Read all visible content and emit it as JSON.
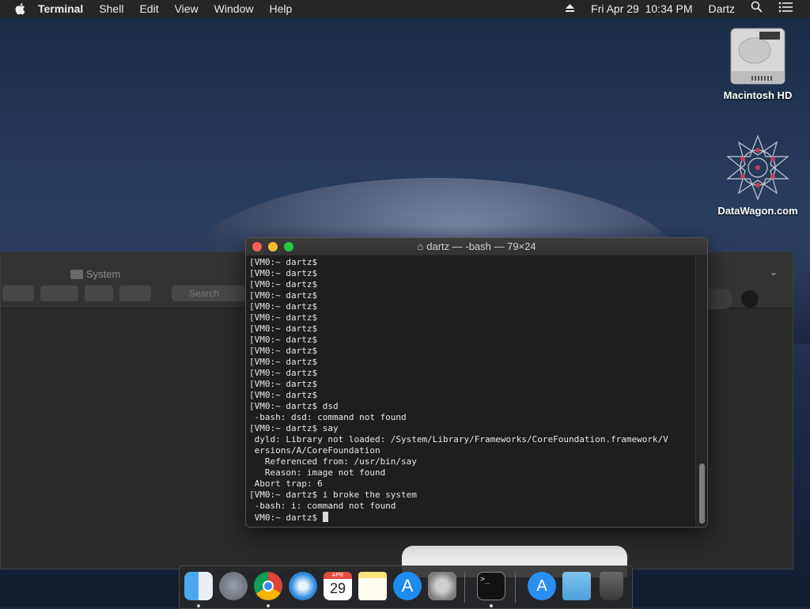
{
  "menubar": {
    "app_name": "Terminal",
    "menus": [
      "Shell",
      "Edit",
      "View",
      "Window",
      "Help"
    ],
    "date_time": "Fri Apr 29  10:34 PM",
    "user": "Dartz"
  },
  "desktop": {
    "icons": [
      {
        "label": "Macintosh HD",
        "icon": "hard-drive-icon"
      },
      {
        "label": "DataWagon.com",
        "icon": "geometric-star-icon"
      }
    ]
  },
  "finder": {
    "title": "System",
    "search_placeholder": "Search"
  },
  "terminal": {
    "title": "dartz — -bash — 79×24",
    "lines": [
      "[VM0:~ dartz$",
      "[VM0:~ dartz$",
      "[VM0:~ dartz$",
      "[VM0:~ dartz$",
      "[VM0:~ dartz$",
      "[VM0:~ dartz$",
      "[VM0:~ dartz$",
      "[VM0:~ dartz$",
      "[VM0:~ dartz$",
      "[VM0:~ dartz$",
      "[VM0:~ dartz$",
      "[VM0:~ dartz$",
      "[VM0:~ dartz$",
      "[VM0:~ dartz$ dsd",
      " -bash: dsd: command not found",
      "[VM0:~ dartz$ say",
      " dyld: Library not loaded: /System/Library/Frameworks/CoreFoundation.framework/V",
      " ersions/A/CoreFoundation",
      "   Referenced from: /usr/bin/say",
      "   Reason: image not found",
      " Abort trap: 6",
      "[VM0:~ dartz$ i broke the system",
      " -bash: i: command not found",
      " VM0:~ dartz$ "
    ]
  },
  "dock": {
    "calendar_month": "APR",
    "calendar_day": "29",
    "items": [
      "finder-icon",
      "launchpad-icon",
      "chrome-icon",
      "safari-icon",
      "calendar-icon",
      "notes-icon",
      "app-store-icon",
      "system-preferences-icon",
      "terminal-icon",
      "app-store-downloads-icon",
      "downloads-folder-icon",
      "trash-icon"
    ]
  }
}
